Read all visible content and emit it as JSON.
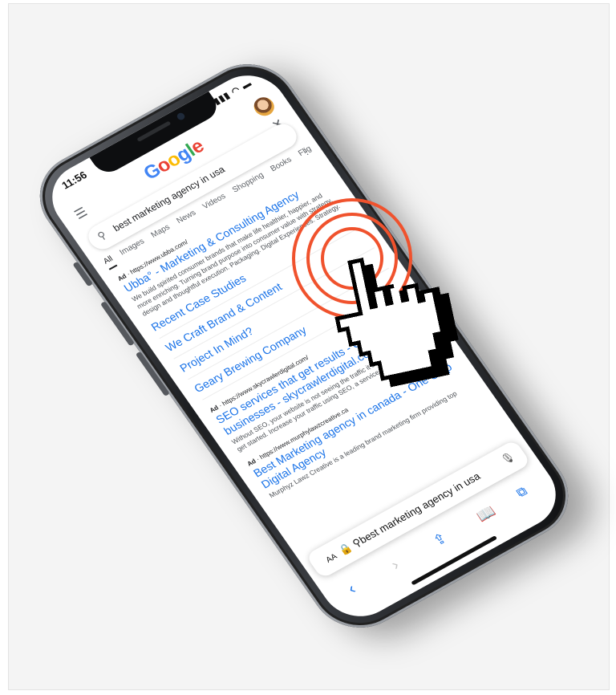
{
  "status_bar": {
    "time": "11:56",
    "icons": "▮▮▮ ◠ ▬"
  },
  "google": {
    "logo_letters": [
      {
        "ch": "G",
        "color": "#4285F4"
      },
      {
        "ch": "o",
        "color": "#EA4335"
      },
      {
        "ch": "o",
        "color": "#FBBC05"
      },
      {
        "ch": "g",
        "color": "#4285F4"
      },
      {
        "ch": "l",
        "color": "#34A853"
      },
      {
        "ch": "e",
        "color": "#EA4335"
      }
    ],
    "search_query": "best marketing agency in usa",
    "tabs": [
      "All",
      "Images",
      "Maps",
      "News",
      "Videos",
      "Shopping",
      "Books",
      "Flig"
    ]
  },
  "results": [
    {
      "ad_label": "Ad",
      "url": "https://www.ubba.com/",
      "title": "Ubba° - Marketing & Consulting Agency",
      "snippet": "We build spirited consumer brands that make life healthier, happier, and more enriching. Turning brand purpose into consumer value with strategy, design and thoughtful execution. Packaging. Digital Experiences. Strategy.",
      "sitelinks": [
        "Recent Case Studies",
        "We Craft Brand & Content",
        "Project In Mind?",
        "Geary Brewing Company"
      ]
    },
    {
      "ad_label": "Ad",
      "url": "https://www.skycrawlerdigital.com/",
      "title": "SEO services that get results - Grow businesses - skycrawlerdigital.com",
      "snippet": "Without SEO, your website is not seeing the traffic it should. Contact us to get started. Increase your traffic using SEO, a service proven to work..."
    },
    {
      "ad_label": "Ad",
      "url": "https://www.murphylawzcreative.ca",
      "title": "Best Marketing agency in canada - One-Stop Digital Agency",
      "snippet": "Murphyz Lawz Creative is a leading brand marketing firm providing top"
    }
  ],
  "safari": {
    "aa_label": "AA",
    "url_text": "best marketing agency in usa"
  },
  "icons": {
    "menu": "hamburger-menu-icon",
    "close": "close-icon",
    "search": "search-icon",
    "mic": "microphone-icon",
    "back": "back-chevron-icon",
    "forward": "forward-chevron-icon",
    "share": "share-icon",
    "bookmarks": "book-icon",
    "tabs": "tabs-icon",
    "cursor": "pointing-hand-cursor-icon"
  },
  "colors": {
    "link_blue": "#1a73e8",
    "ring_orange": "#f0522d"
  }
}
